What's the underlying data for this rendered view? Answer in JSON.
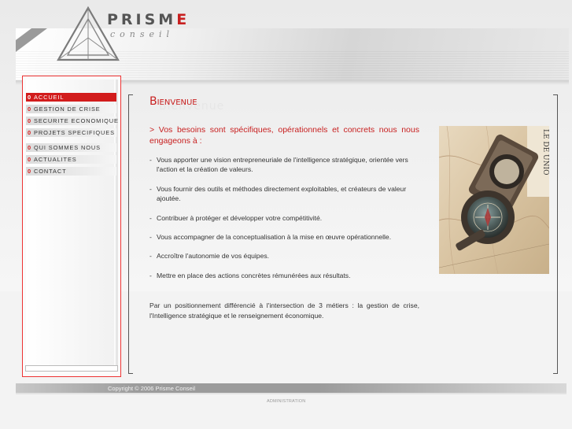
{
  "brand": {
    "name_main": "PRISM",
    "name_accent": "E",
    "tagline": "conseil"
  },
  "menu": [
    {
      "label": "ACCUEIL",
      "bullet": "0",
      "active": true
    },
    {
      "label": "GESTION DE CRISE",
      "bullet": "0"
    },
    {
      "label": "SECURITE ECONOMIQUE",
      "bullet": "0"
    },
    {
      "label": "PROJETS SPECIFIQUES",
      "bullet": "0"
    },
    {
      "label": "QUI SOMMES NOUS",
      "bullet": "0"
    },
    {
      "label": "ACTUALITES",
      "bullet": "0"
    },
    {
      "label": "CONTACT",
      "bullet": "0"
    }
  ],
  "content": {
    "title": "Bienvenue",
    "intro": "> Vos besoins sont spécifiques, opérationnels et concrets nous nous engageons à :",
    "bullet_marker": "-",
    "bullets": [
      "Vous apporter une vision entrepreneuriale de l'intelligence stratégique, orientée vers l'action et la création de valeurs.",
      "Vous fournir des outils et méthodes directement exploitables, et créateurs de valeur ajoutée.",
      "Contribuer à protéger et développer votre compétitivité.",
      "Vous accompagner de la conceptualisation à la mise en œuvre opérationnelle.",
      "Accroître l'autonomie de vos équipes.",
      "Mettre en place des actions concrètes rémunérées aux résultats."
    ],
    "outro": "Par un positionnement différencié à l'intersection de 3 métiers : la gestion de crise, l'Intelligence stratégique et le renseignement économique."
  },
  "photo": {
    "map_text": "LE DE UNIO"
  },
  "footer": {
    "copyright": "Copyright © 2006 Prisme Conseil",
    "admin_link": "ADMINISTRATION"
  },
  "colors": {
    "accent": "#d21c1c",
    "text": "#333333"
  }
}
